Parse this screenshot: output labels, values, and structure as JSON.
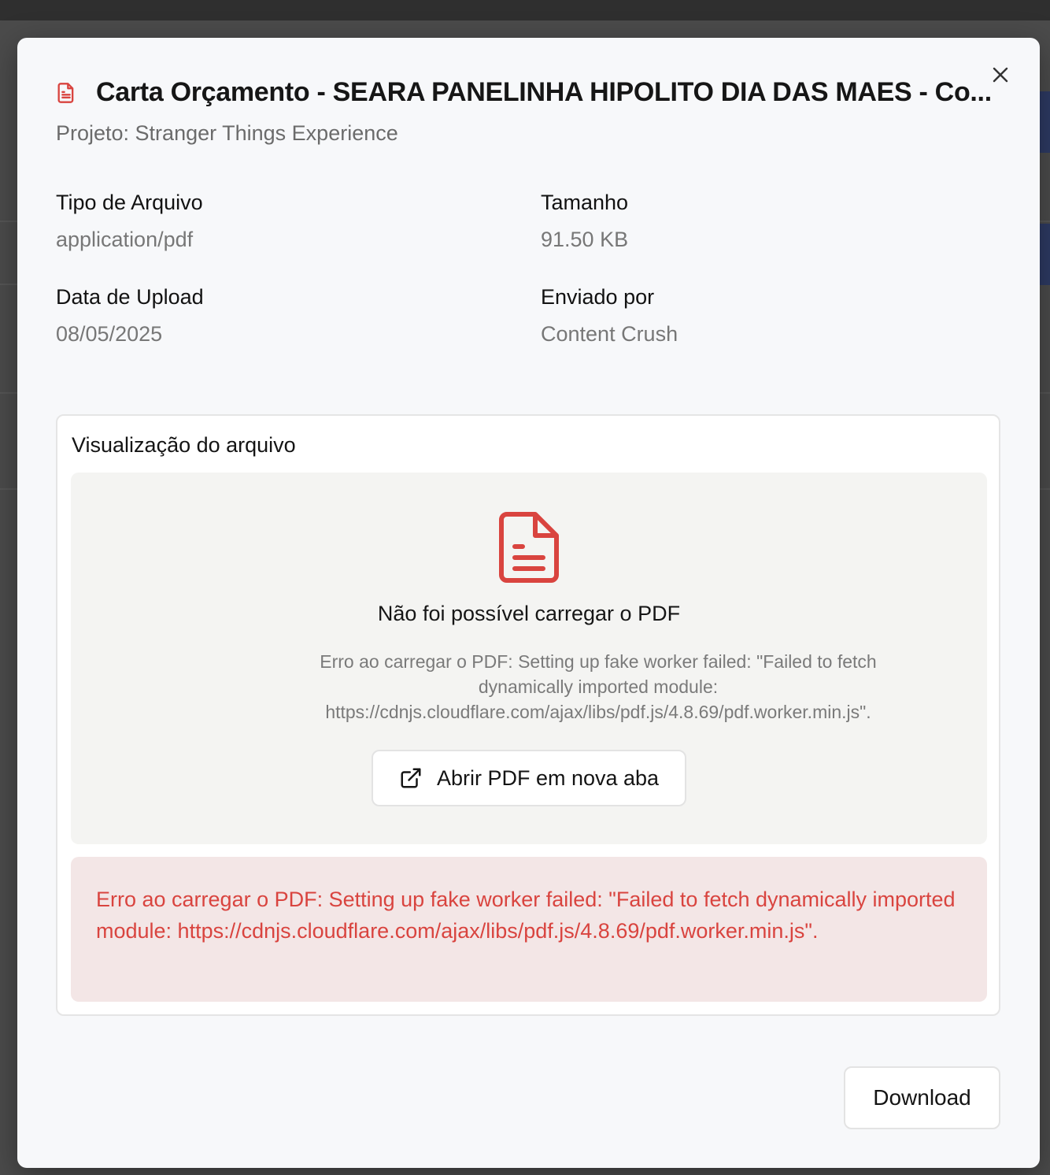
{
  "modal": {
    "title": "Carta Orçamento - SEARA PANELINHA HIPOLITO DIA DAS MAES - Co...",
    "subtitle": "Projeto: Stranger Things Experience",
    "close_icon": "close-icon",
    "title_icon": "file-text-icon"
  },
  "details": {
    "file_type": {
      "label": "Tipo de Arquivo",
      "value": "application/pdf"
    },
    "size": {
      "label": "Tamanho",
      "value": "91.50 KB"
    },
    "upload_date": {
      "label": "Data de Upload",
      "value": "08/05/2025"
    },
    "sent_by": {
      "label": "Enviado por",
      "value": "Content Crush"
    }
  },
  "preview": {
    "title": "Visualização do arquivo",
    "fail_title": "Não foi possível carregar o PDF",
    "fail_detail": "Erro ao carregar o PDF: Setting up fake worker failed: \"Failed to fetch dynamically imported module: https://cdnjs.cloudflare.com/ajax/libs/pdf.js/4.8.69/pdf.worker.min.js\".",
    "open_button": "Abrir PDF em nova aba",
    "error_message": "Erro ao carregar o PDF: Setting up fake worker failed: \"Failed to fetch dynamically imported module: https://cdnjs.cloudflare.com/ajax/libs/pdf.js/4.8.69/pdf.worker.min.js\"."
  },
  "footer": {
    "download_label": "Download"
  },
  "colors": {
    "accent_red": "#d9443f",
    "error_bg": "#f3e6e6"
  }
}
